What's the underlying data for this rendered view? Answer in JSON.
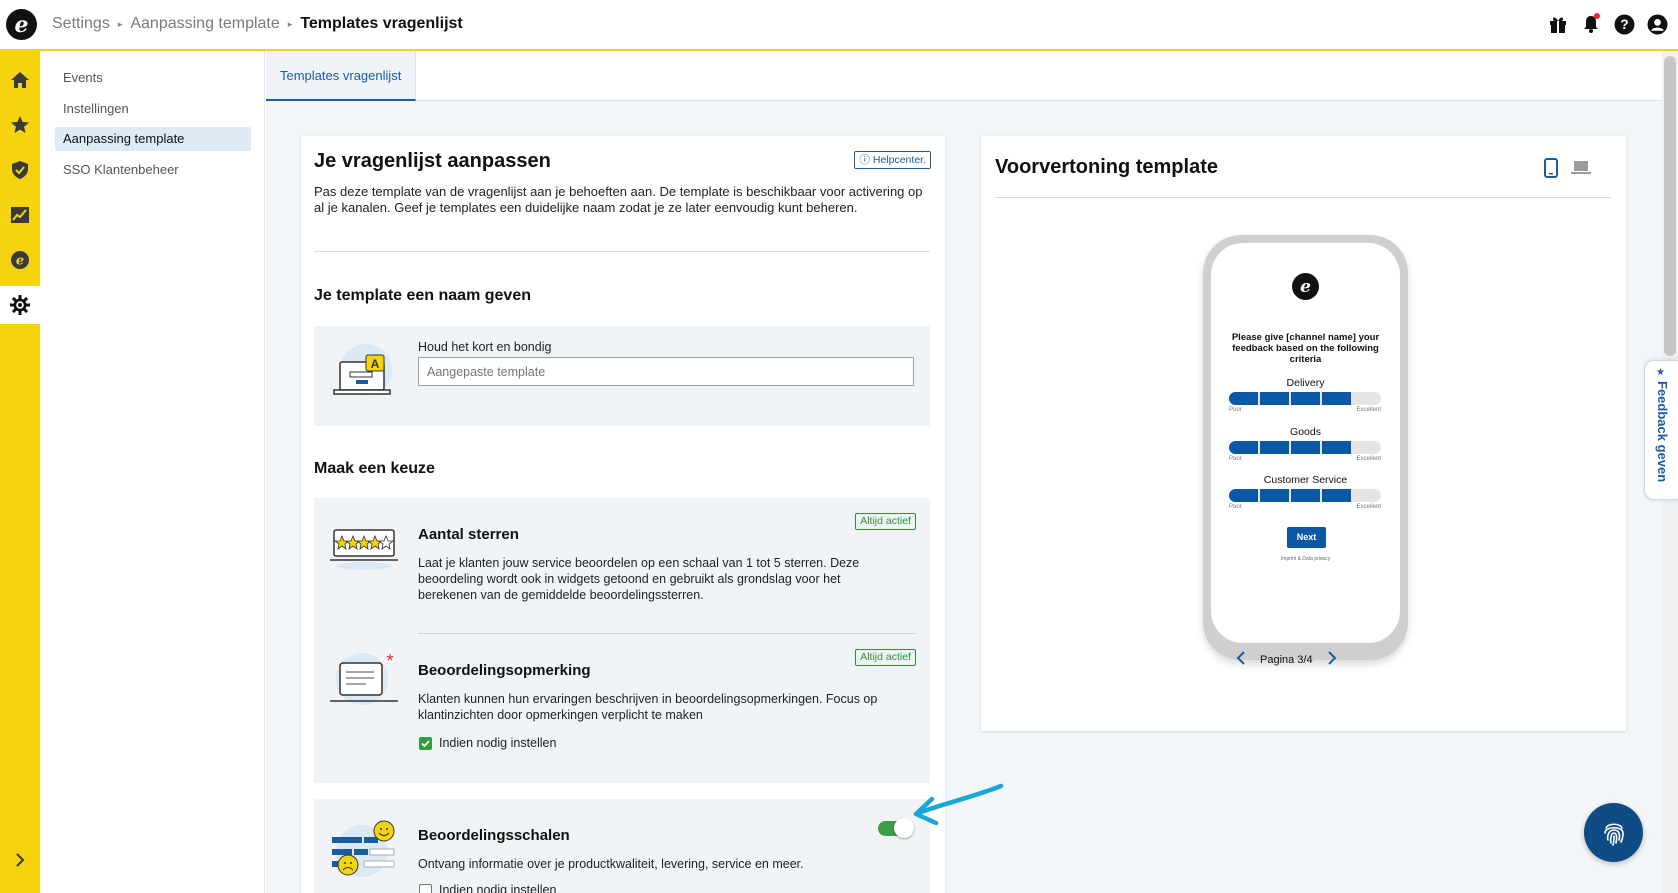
{
  "header": {
    "logo_letter": "e",
    "breadcrumb": [
      "Settings",
      "Aanpassing template",
      "Templates vragenlijst"
    ],
    "icons": [
      "gift-icon",
      "bell-icon",
      "help-icon",
      "user-icon"
    ]
  },
  "rail": {
    "icons": [
      "home-icon",
      "star-icon",
      "shield-icon",
      "chart-icon",
      "trusted-logo-icon",
      "gear-icon"
    ],
    "collapse_icon": "chevron-right-icon"
  },
  "subnav": {
    "items": [
      "Events",
      "Instellingen",
      "Aanpassing template",
      "SSO Klantenbeheer"
    ],
    "active": "Aanpassing template"
  },
  "tabs": {
    "active_label": "Templates vragenlijst"
  },
  "editor": {
    "title": "Je vragenlijst aanpassen",
    "help_label": "Helpcenter.",
    "intro": "Pas deze template van de vragenlijst aan je behoeften aan. De template is beschikbaar voor activering op al je kanalen. Geef je templates een duidelijke naam zodat je ze later eenvoudig kunt beheren.",
    "name_section": {
      "heading": "Je template een naam geven",
      "field_label": "Houd het kort en bondig",
      "placeholder": "Aangepaste template"
    },
    "choice_heading": "Maak een keuze",
    "options": [
      {
        "title": "Aantal sterren",
        "badge": "Altijd actief",
        "text": "Laat je klanten jouw service beoordelen op een schaal van 1 tot 5 sterren. Deze beoordeling wordt ook in widgets getoond en gebruikt als grondslag voor het berekenen van de gemiddelde beoordelingssterren."
      },
      {
        "title": "Beoordelingsopmerking",
        "badge": "Altijd actief",
        "text": "Klanten kunnen hun ervaringen beschrijven in beoordelingsopmerkingen. Focus op klantinzichten door opmerkingen verplicht te maken",
        "checkbox_label": "Indien nodig instellen",
        "checked": true
      },
      {
        "title": "Beoordelingsschalen",
        "text": "Ontvang informatie over je productkwaliteit, levering, service en meer.",
        "checkbox_label": "Indien nodig instellen",
        "checked": false,
        "toggle_on": true
      }
    ]
  },
  "preview": {
    "title": "Voorvertoning template",
    "device_icons": [
      "mobile-icon",
      "laptop-icon"
    ],
    "phone": {
      "question": "Please give [channel name] your feedback based on the following criteria",
      "criteria": [
        {
          "name": "Delivery",
          "filled_segments": 4,
          "total_segments": 5
        },
        {
          "name": "Goods",
          "filled_segments": 4,
          "total_segments": 5
        },
        {
          "name": "Customer Service",
          "filled_segments": 4,
          "total_segments": 5
        }
      ],
      "scale_low": "Poor",
      "scale_high": "Excellent",
      "next_label": "Next",
      "footer_link": "Imprint & Data privacy"
    },
    "pager_label": "Pagina 3/4"
  },
  "feedback_tab": {
    "label": "Feedback geven"
  },
  "colors": {
    "brand_yellow": "#f5d30f",
    "primary_blue": "#1b5c9e",
    "success_green": "#2d8f3a",
    "arrow_cyan": "#1aa7d8"
  }
}
